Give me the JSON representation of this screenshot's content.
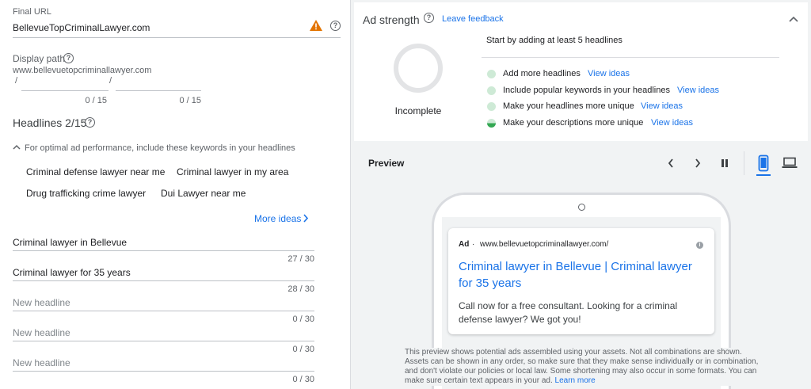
{
  "final_url": {
    "label": "Final URL",
    "value": "BellevueTopCriminalLawyer.com"
  },
  "display_path": {
    "label": "Display path",
    "domain": "www.bellevuetopcriminallawyer.com",
    "slash1": "/",
    "slash2": "/",
    "count1": "0 / 15",
    "count2": "0 / 15"
  },
  "headlines": {
    "title": "Headlines 2/15",
    "hint": "For optimal ad performance, include these keywords in your headlines",
    "keywords": [
      "Criminal defense lawyer near me",
      "Criminal lawyer in my area",
      "Drug trafficking crime lawyer",
      "Dui Lawyer near me"
    ],
    "more_ideas": "More ideas",
    "items": [
      {
        "text": "Criminal lawyer in Bellevue",
        "placeholder": "",
        "count": "27 / 30"
      },
      {
        "text": "Criminal lawyer for 35 years",
        "placeholder": "",
        "count": "28 / 30"
      },
      {
        "text": "",
        "placeholder": "New headline",
        "count": "0 / 30"
      },
      {
        "text": "",
        "placeholder": "New headline",
        "count": "0 / 30"
      },
      {
        "text": "",
        "placeholder": "New headline",
        "count": "0 / 30"
      }
    ]
  },
  "ad_strength": {
    "title": "Ad strength",
    "feedback": "Leave feedback",
    "status": "Incomplete",
    "intro": "Start by adding at least 5 headlines",
    "tips": [
      {
        "text": "Add more headlines",
        "link": "View ideas"
      },
      {
        "text": "Include popular keywords in your headlines",
        "link": "View ideas"
      },
      {
        "text": "Make your headlines more unique",
        "link": "View ideas"
      },
      {
        "text": "Make your descriptions more unique",
        "link": "View ideas"
      }
    ]
  },
  "preview": {
    "title": "Preview",
    "ad": {
      "badge": "Ad",
      "separator": "·",
      "url": "www.bellevuetopcriminallawyer.com/",
      "headline_line1": "Criminal lawyer in Bellevue | Criminal lawyer",
      "headline_line2": "for 35 years",
      "desc_line1": "Call now for a free consultant. Looking for a criminal",
      "desc_line2": "defense lawyer? We got you!"
    },
    "disclaimer": "This preview shows potential ads assembled using your assets. Not all combinations are shown. Assets can be shown in any order, so make sure that they make sense individually or in combination, and don't violate our policies or local law. Some shortening may also occur in some formats. You can make sure certain text appears in your ad.",
    "learn_more": "Learn more"
  },
  "colors": {
    "link": "#1a73e8",
    "warning": "#e37400",
    "active_device": "#1a73e8"
  },
  "icons": [
    "warning-icon",
    "help-icon",
    "chevron-up-icon",
    "chevron-right-icon",
    "chevron-left-icon",
    "pause-icon",
    "mobile-icon",
    "laptop-icon",
    "info-icon"
  ]
}
